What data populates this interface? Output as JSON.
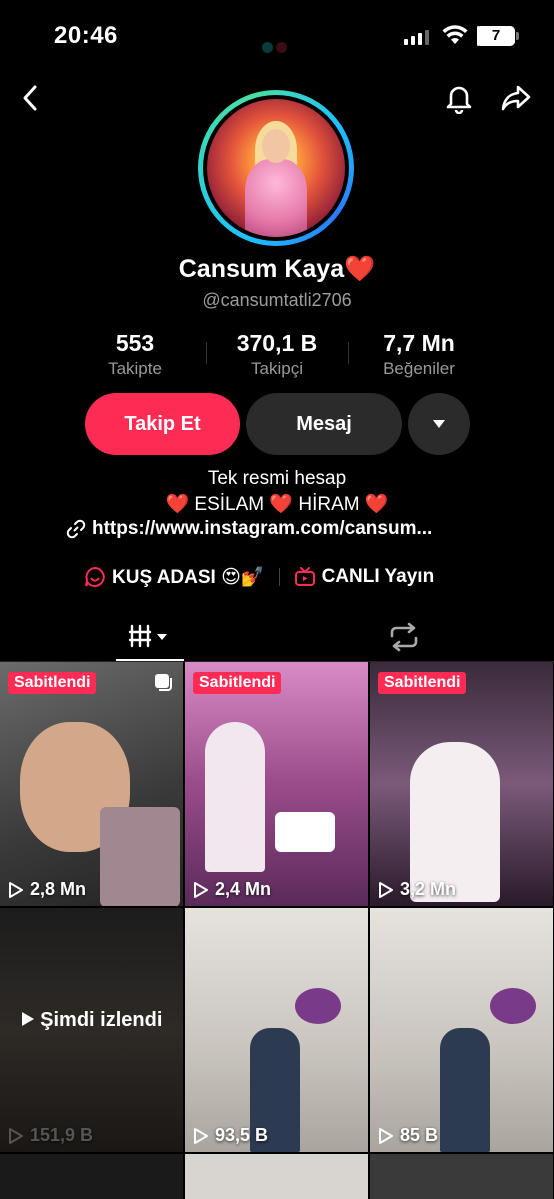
{
  "status_bar": {
    "time": "20:46",
    "battery": "7",
    "battery_fraction": 0.07
  },
  "profile": {
    "name": "Cansum Kaya❤️",
    "handle": "@cansumtatli2706"
  },
  "stats": [
    {
      "value": "553",
      "label": "Takipte"
    },
    {
      "value": "370,1 B",
      "label": "Takipçi"
    },
    {
      "value": "7,7 Mn",
      "label": "Beğeniler"
    }
  ],
  "actions": {
    "follow": "Takip Et",
    "message": "Mesaj"
  },
  "bio": {
    "line1": "Tek resmi hesap",
    "line2": "❤️ ESİLAM ❤️ HİRAM ❤️",
    "link": "https://www.instagram.com/cansum..."
  },
  "chips": [
    {
      "label": "KUŞ ADASI 😍💅"
    },
    {
      "label": "CANLI Yayın"
    }
  ],
  "grid": [
    {
      "pinned": "Sabitlendi",
      "views": "2,8 Mn",
      "bg": "#5a5a5a"
    },
    {
      "pinned": "Sabitlendi",
      "views": "2,4 Mn",
      "bg": "#b05a9a"
    },
    {
      "pinned": "Sabitlendi",
      "views": "3,2 Mn",
      "bg": "#6a4a6a"
    },
    {
      "pinned": "",
      "views": "151,9 B",
      "watched": "Şimdi izlendi",
      "bg": "#2a2622"
    },
    {
      "pinned": "",
      "views": "93,5 B",
      "bg": "#cfcac4"
    },
    {
      "pinned": "",
      "views": "85 B",
      "bg": "#cfcac4"
    }
  ],
  "colors": {
    "accent": "#fe2c55",
    "secondary_button": "#2b2b2b",
    "muted_text": "#9a9a9a"
  }
}
